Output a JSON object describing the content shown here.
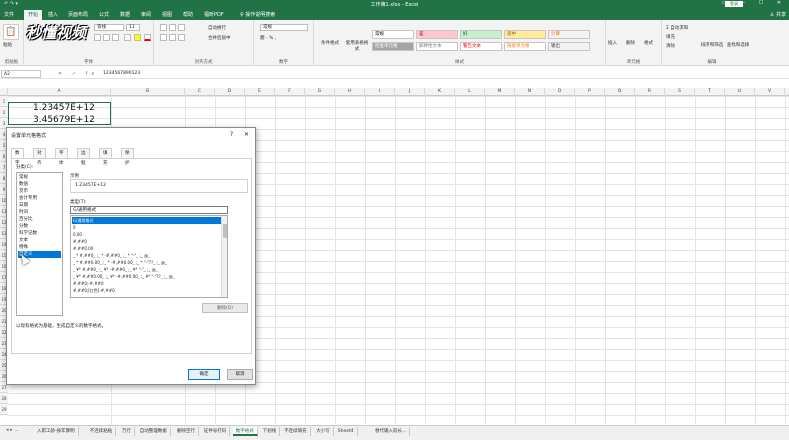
{
  "window": {
    "title": "工作簿1.xlsx - Excel",
    "login_label": "登录",
    "quick_access": "↶ ↷ ▾",
    "controls": "▭ — ☐ ✕"
  },
  "ribbon_tabs": [
    "文件",
    "开始",
    "插入",
    "页面布局",
    "公式",
    "数据",
    "审阅",
    "视图",
    "帮助",
    "福昕PDF",
    "操作说明搜索"
  ],
  "active_ribbon_tab": "开始",
  "share_label": "共享",
  "ribbon": {
    "clipboard_label": "剪贴板",
    "paste_label": "粘贴",
    "font_label": "字体",
    "font_name": "等线",
    "font_size": "11",
    "align_label": "对齐方式",
    "wrap_text": "自动换行",
    "merge_center": "合并后居中",
    "number_label": "数字",
    "number_format": "常规",
    "cond_format": "条件格式",
    "table_format": "套用表格格式",
    "styles_label": "样式",
    "style_cells": [
      {
        "label": "常规",
        "bg": "#ffffff",
        "color": "#000000"
      },
      {
        "label": "差",
        "bg": "#ffc7ce",
        "color": "#9c0006"
      },
      {
        "label": "好",
        "bg": "#c6efce",
        "color": "#006100"
      },
      {
        "label": "适中",
        "bg": "#ffeb9c",
        "color": "#9c5700"
      },
      {
        "label": "计算",
        "bg": "#f2f2f2",
        "color": "#fa7d00"
      },
      {
        "label": "检查单元格",
        "bg": "#a5a5a5",
        "color": "#ffffff"
      },
      {
        "label": "解释性文本",
        "bg": "#ffffff",
        "color": "#7f7f7f"
      },
      {
        "label": "警告文本",
        "bg": "#ffffff",
        "color": "#ff0000"
      },
      {
        "label": "链接单元格",
        "bg": "#ffffff",
        "color": "#fa7d00"
      },
      {
        "label": "输出",
        "bg": "#f2f2f2",
        "color": "#3f3f3f"
      }
    ],
    "cells_label": "单元格",
    "insert": "插入",
    "delete": "删除",
    "format": "格式",
    "editing_label": "编辑",
    "autosum": "自动求和",
    "fill": "填充",
    "clear": "清除",
    "sort_filter": "排序和筛选",
    "find_select": "查找和选择"
  },
  "watermark": "秒懂视频",
  "formula_bar": {
    "name_box": "A2",
    "fx_icons": "✕ ✓ fx",
    "value": "12345678901​23"
  },
  "columns": [
    "A",
    "B",
    "C",
    "D",
    "E",
    "F",
    "G",
    "H",
    "I",
    "J",
    "K",
    "L",
    "M",
    "N",
    "O",
    "P",
    "Q",
    "R",
    "S",
    "T",
    "U",
    "V"
  ],
  "rows": [
    "1",
    "2",
    "3",
    "4",
    "5",
    "6",
    "7",
    "8",
    "9",
    "10",
    "11",
    "12",
    "13",
    "14",
    "15",
    "16",
    "17",
    "18",
    "19",
    "20",
    "21",
    "22",
    "23",
    "24",
    "25",
    "26",
    "27",
    "28",
    "29",
    "30"
  ],
  "cells": {
    "a2": "1.23457E+12",
    "a3": "3.45679E+12"
  },
  "sheet_tabs": [
    "入职工龄-按年算明",
    "不连续粘贴",
    "万行",
    "自动整理数据",
    "删除空行",
    "证件号打码",
    "数字格式",
    "下划线",
    "不连续填充",
    "大小写",
    "Sheet4",
    "替代输入较长..."
  ],
  "active_sheet": "数字格式",
  "sheet_nav": "◂ ▸ ...",
  "dialog": {
    "title": "设置单元格格式",
    "help": "?",
    "close": "✕",
    "tabs": [
      "数字",
      "对齐",
      "字体",
      "边框",
      "填充",
      "保护"
    ],
    "active_tab": "数字",
    "category_label": "分类(C):",
    "categories": [
      "常规",
      "数值",
      "货币",
      "会计专用",
      "日期",
      "时间",
      "百分比",
      "分数",
      "科学记数",
      "文本",
      "特殊",
      "自定义"
    ],
    "selected_category": "自定义",
    "sample_label": "示例",
    "sample_value": "1.23457E+12",
    "type_label": "类型(T):",
    "type_input": "G/通用格式",
    "types": [
      "G/通用格式",
      "0",
      "0.00",
      "#,##0",
      "#,##0.00",
      "_ * #,##0_ ;_ * -#,##0_ ;_ * \"-\"_ ;_ @_",
      "_ * #,##0.00_ ;_ * -#,##0.00_ ;_ * \"-\"??_ ;_ @_",
      "_ ¥* #,##0_ ;_ ¥* -#,##0_ ;_ ¥* \"-\"_ ;_ @_",
      "_ ¥* #,##0.00_ ;_ ¥* -#,##0.00_ ;_ ¥* \"-\"??_ ;_ @_",
      "#,##0;-#,##0",
      "#,##0;[红色]-#,##0"
    ],
    "selected_type": "G/通用格式",
    "delete_label": "删除(D)",
    "description": "以现有格式为基础，生成自定义的数字格式。",
    "ok_label": "确定",
    "cancel_label": "取消"
  }
}
